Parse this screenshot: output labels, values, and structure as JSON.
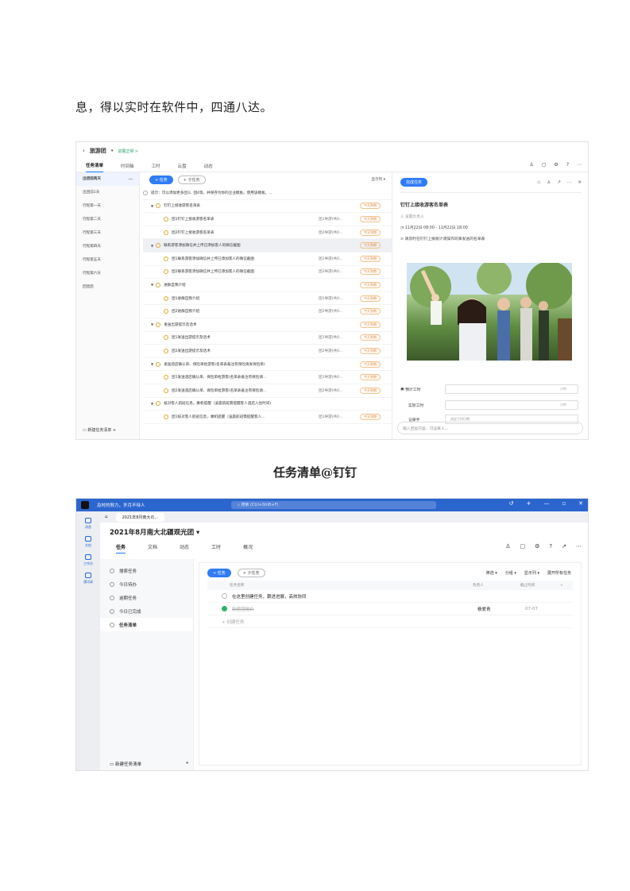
{
  "intro_text": "息，得以实时在软件中，四通八达。",
  "caption": "任务清单@钉钉",
  "shot1": {
    "project": "旅游团",
    "status": "进展正常 >",
    "tabs": [
      "任务清单",
      "时间轴",
      "工时",
      "云盘",
      "动态"
    ],
    "sidebar": [
      "出团前两天",
      "出团前1天",
      "行程第一天",
      "行程第二天",
      "行程第三天",
      "行程第四天",
      "行程第五天",
      "行程第六天",
      "回团后"
    ],
    "sidebar_more": "...",
    "new_list": "新建任务清单",
    "add_task": "+ 任务",
    "add_subtask": "+ 子任务",
    "display": "显示列",
    "rows": [
      {
        "name": "提示：可以添加更多团3、团4等，并保存为你的企业模板。使用该模板，...",
        "assignee": "",
        "tag": "",
        "kind": "tip"
      },
      {
        "name": "钉钉上接收游客名单表",
        "assignee": "",
        "tag": "今天到期",
        "kind": "par"
      },
      {
        "name": "团1钉钉上接收游客名单表",
        "assignee": "团1导游(共0...",
        "tag": "今天到期",
        "kind": "sub"
      },
      {
        "name": "团2钉钉上接收游客名单表",
        "assignee": "团2导游(共0...",
        "tag": "今天到期",
        "kind": "sub"
      },
      {
        "name": "联系游客添加微信并上传已添加客人的微信截图",
        "assignee": "",
        "tag": "今天到期",
        "kind": "par hl"
      },
      {
        "name": "团1联系游客添加微信并上传已添加客人的微信截图",
        "assignee": "团1导游(共0...",
        "tag": "今天到期",
        "kind": "sub"
      },
      {
        "name": "团2联系游客添加微信并上传已添加客人的微信截图",
        "assignee": "团2导游(共0...",
        "tag": "今天到期",
        "kind": "sub"
      },
      {
        "name": "进群自我介绍",
        "assignee": "",
        "tag": "今天到期",
        "kind": "par"
      },
      {
        "name": "团1进群自我介绍",
        "assignee": "团1导游(共0...",
        "tag": "今天到期",
        "kind": "sub"
      },
      {
        "name": "团2进群自我介绍",
        "assignee": "团2导游(共0...",
        "tag": "今天到期",
        "kind": "sub"
      },
      {
        "name": "发送出游提示及话术",
        "assignee": "",
        "tag": "今天到期",
        "kind": "par"
      },
      {
        "name": "团1发送出游提示及话术",
        "assignee": "团1导游(共0...",
        "tag": "今天到期",
        "kind": "sub"
      },
      {
        "name": "团2发送出游提示及话术",
        "assignee": "团2导游(共0...",
        "tag": "今天到期",
        "kind": "sub"
      },
      {
        "name": "发送酒店确认单、保险单给游客(名单表备注有保险请发保险单)",
        "assignee": "",
        "tag": "今天到期",
        "kind": "par"
      },
      {
        "name": "团1发送酒店确认单、保险单给游客(名单表备注有保险请...",
        "assignee": "团1导游(共0...",
        "tag": "今天到期",
        "kind": "sub"
      },
      {
        "name": "团2发送酒店确认单、保险单给游客(名单表备注有保险请...",
        "assignee": "团2导游(共0...",
        "tag": "今天到期",
        "kind": "sub"
      },
      {
        "name": "核对客人航班信息，乘机提醒（凌晨航班需提醒客人酒店入住时间)",
        "assignee": "",
        "tag": "",
        "kind": "par"
      },
      {
        "name": "团1核对客人航班信息，乘机提醒（凌晨航班需提醒客人...",
        "assignee": "团1导游(共0...",
        "tag": "今天到期",
        "kind": "sub"
      }
    ],
    "detail": {
      "complete": "完成任务",
      "title": "钉钉上接收游客名单表",
      "assignee": "设置负责人",
      "time": "11月22日 08:00 - 11月22日 18:00",
      "desc": "请及时在钉钉上接收计调操作同事发送的名单表",
      "est": "预计工时",
      "actual": "实际工时",
      "recorder": "记录手",
      "hour": "小时",
      "pick": "选定工时日期",
      "reply": "输入回复内容，可@某人..."
    }
  },
  "shot2": {
    "motto": "及时的努力，岁月不待人",
    "search": "搜索 (Ctrl+Shift+F)",
    "browser_tab": "2021年8月南大の...",
    "nav": [
      "消息",
      "文档",
      "工作台",
      "通讯录"
    ],
    "title": "2021年8月南大北疆观光团",
    "tabs": [
      "任务",
      "文档",
      "动态",
      "工时",
      "概况"
    ],
    "side": [
      "搜索任务",
      "今日待办",
      "逾期任务",
      "今日已完成",
      "任务清单"
    ],
    "new_list": "新建任务清单",
    "add_task": "+ 任务",
    "add_subtask": "+ 子任务",
    "filters": [
      "筛选",
      "分组",
      "显示列",
      "展开所有任务"
    ],
    "cols": [
      "任务名称",
      "负责人",
      "截止时间"
    ],
    "row1": "在这里创建任务，跟进进展，高效协同",
    "row2": "新建团报价",
    "row2_owner": "杨爱青",
    "row2_date": "07-07",
    "row3": "+ 创建任务"
  }
}
